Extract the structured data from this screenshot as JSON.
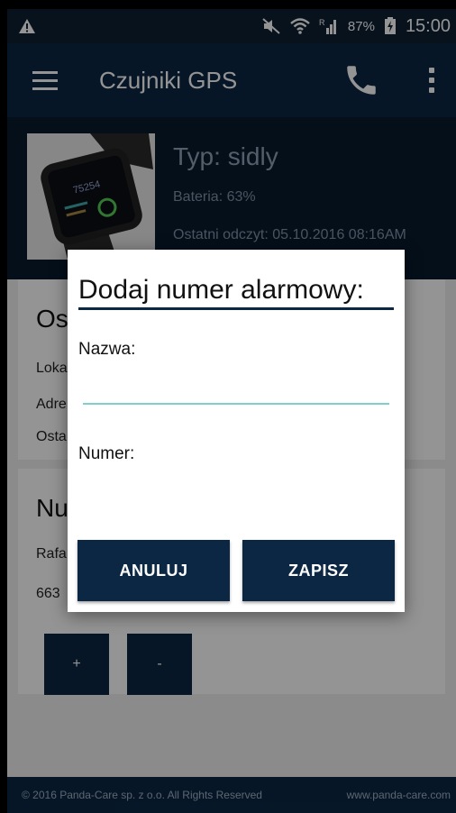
{
  "status_bar": {
    "battery_percent": "87%",
    "time": "15:00"
  },
  "app_bar": {
    "title": "Czujniki GPS"
  },
  "device": {
    "type": "Typ: sidly",
    "battery": "Bateria: 63%",
    "last_reading": "Ostatni odczyt: 05.10.2016 08:16AM"
  },
  "card_location": {
    "title": "Os",
    "lines": [
      "Loka",
      "Adre",
      "Osta"
    ]
  },
  "card_numbers": {
    "title": "Nu",
    "lines": [
      "Rafa",
      "663"
    ],
    "add_label": "+",
    "remove_label": "-"
  },
  "dialog": {
    "title": "Dodaj numer alarmowy:",
    "name_label": "Nazwa:",
    "name_value": "",
    "number_label": "Numer:",
    "number_value": "",
    "cancel_label": "ANULUJ",
    "save_label": "ZAPISZ"
  },
  "footer": {
    "copyright": "© 2016 Panda-Care sp. z o.o. All Rights Reserved",
    "website": "www.panda-care.com"
  },
  "colors": {
    "primary": "#0b2744",
    "status_bar": "#0d1f33",
    "input_underline": "#7fcfcc"
  }
}
